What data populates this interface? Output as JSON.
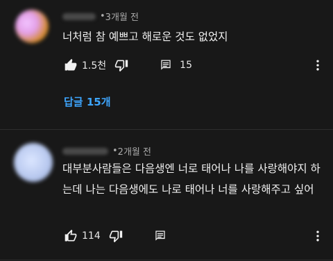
{
  "comments": [
    {
      "time": "3개월 전",
      "text": "너처럼 참 예쁘고 해로운 것도 없었지",
      "likes": "1.5천",
      "replies_count": "15",
      "replies_link": "답글 15개"
    },
    {
      "time": "2개월 전",
      "text": "대부분사람들은 다음생엔 너로 태어나 나를 사랑해야지 하는데 나는 다음생에도 나로 태어나 너를 사랑해주고 싶어",
      "likes": "114"
    }
  ],
  "icons": {
    "like": "thumbs-up-icon",
    "dislike": "thumbs-down-icon",
    "reply": "comment-icon",
    "more": "more-vert-icon"
  },
  "colors": {
    "background": "#181818",
    "link": "#3ea6ff",
    "meta": "#aaaaaa",
    "text": "#f1f1f1"
  }
}
